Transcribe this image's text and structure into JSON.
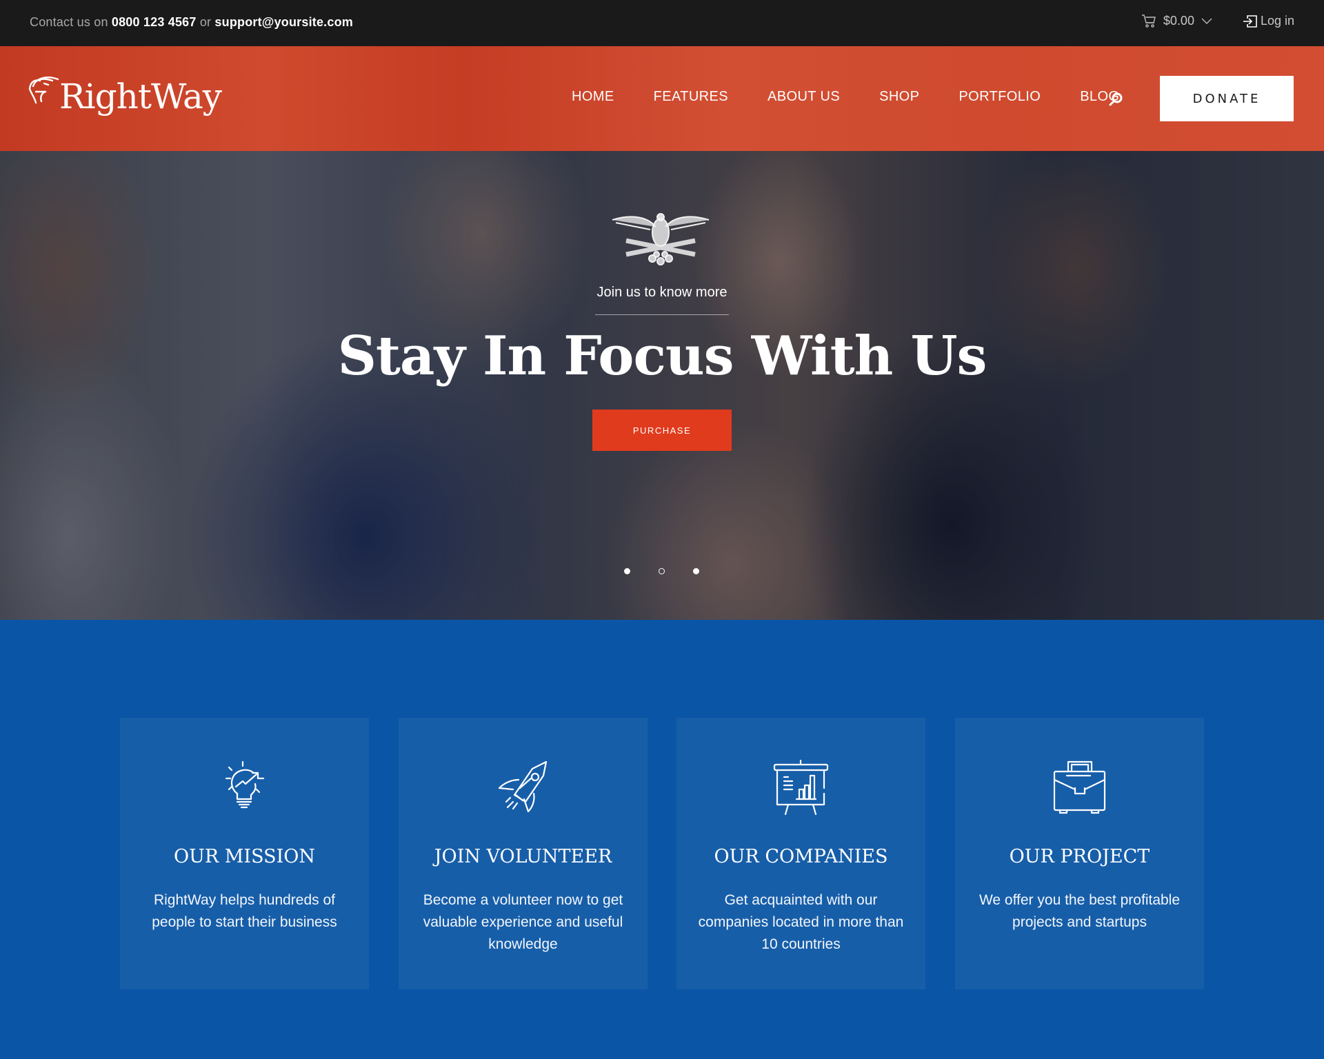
{
  "topbar": {
    "contact_prefix": "Contact us on",
    "phone": "0800 123 4567",
    "contact_or": "or",
    "email": "support@yoursite.com",
    "cart_total": "$0.00",
    "cart_icon": "cart-icon",
    "login_label": "Log in",
    "login_icon": "login-icon"
  },
  "header": {
    "logo_text": "RightWay",
    "logo_icon": "eagle-head-icon",
    "nav": [
      {
        "label": "HOME"
      },
      {
        "label": "FEATURES"
      },
      {
        "label": "ABOUT US"
      },
      {
        "label": "SHOP"
      },
      {
        "label": "PORTFOLIO"
      },
      {
        "label": "BLOG"
      }
    ],
    "search_icon": "search-icon",
    "donate_label": "DONATE",
    "brand_color": "#d04a2f"
  },
  "hero": {
    "emblem_icon": "eagle-cannons-emblem-icon",
    "kicker": "Join us to know more",
    "headline": "Stay In Focus With Us",
    "cta_label": "PURCHASE",
    "cta_color": "#e03b1d",
    "slides_total": 3,
    "active_slide": 2
  },
  "features": {
    "background_color": "#0b55a6",
    "cards": [
      {
        "icon": "lightbulb-growth-icon",
        "title": "OUR MISSION",
        "text": "RightWay helps hundreds of people to start their business"
      },
      {
        "icon": "rocket-icon",
        "title": "JOIN VOLUNTEER",
        "text": "Become a volunteer now to get valuable experience and useful knowledge"
      },
      {
        "icon": "presentation-chart-icon",
        "title": "OUR COMPANIES",
        "text": "Get acquainted with our companies located in more than 10 countries"
      },
      {
        "icon": "briefcase-icon",
        "title": "OUR PROJECT",
        "text": "We offer you the best profitable projects and startups"
      }
    ]
  }
}
